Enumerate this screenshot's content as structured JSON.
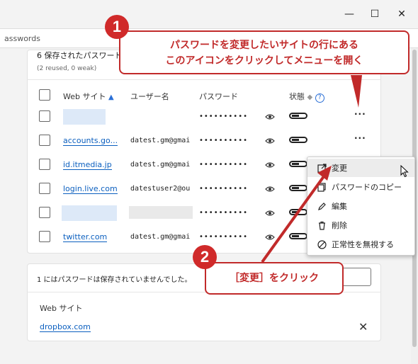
{
  "window": {
    "minimize_glyph": "—",
    "maximize_glyph": "☐",
    "close_glyph": "✕",
    "address_text": "asswords"
  },
  "saved_passwords": {
    "header_title": "6 保存されたパスワード",
    "header_sub": "(2 reused, 0 weak)",
    "columns": {
      "website": "Web サイト",
      "username": "ユーザー名",
      "password": "パスワード",
      "status": "状態"
    },
    "rows": [
      {
        "site": "",
        "user": "",
        "password": "••••••••••"
      },
      {
        "site": "accounts.go...",
        "user": "datest.gm@gmai",
        "password": "••••••••••"
      },
      {
        "site": "id.itmedia.jp",
        "user": "datest.gm@gmai",
        "password": "••••••••••"
      },
      {
        "site": "login.live.com",
        "user": "datestuser2@ou",
        "password": "••••••••••"
      },
      {
        "site": "",
        "user": "",
        "password": "••••••••••"
      },
      {
        "site": "twitter.com",
        "user": "datest.gm@gmai",
        "password": "••••••••••"
      }
    ],
    "more_glyph": "···"
  },
  "context_menu": {
    "items": [
      {
        "label": "変更",
        "icon": "open-external-icon"
      },
      {
        "label": "パスワードのコピー",
        "icon": "copy-icon"
      },
      {
        "label": "編集",
        "icon": "pencil-icon"
      },
      {
        "label": "削除",
        "icon": "trash-icon"
      },
      {
        "label": "正常性を無視する",
        "icon": "block-icon"
      }
    ]
  },
  "never_saved": {
    "title": "1 にはパスワードは保存されていませんでした。",
    "label": "Web サイト",
    "site": "dropbox.com",
    "close_glyph": "✕"
  },
  "annotations": {
    "badge1": "1",
    "callout1_line1": "パスワードを変更したいサイトの行にある",
    "callout1_line2": "このアイコンをクリックしてメニューを開く",
    "badge2": "2",
    "callout2": "［変更］をクリック"
  },
  "colors": {
    "accent_red": "#c12a2a",
    "link_blue": "#0b5fbf"
  }
}
